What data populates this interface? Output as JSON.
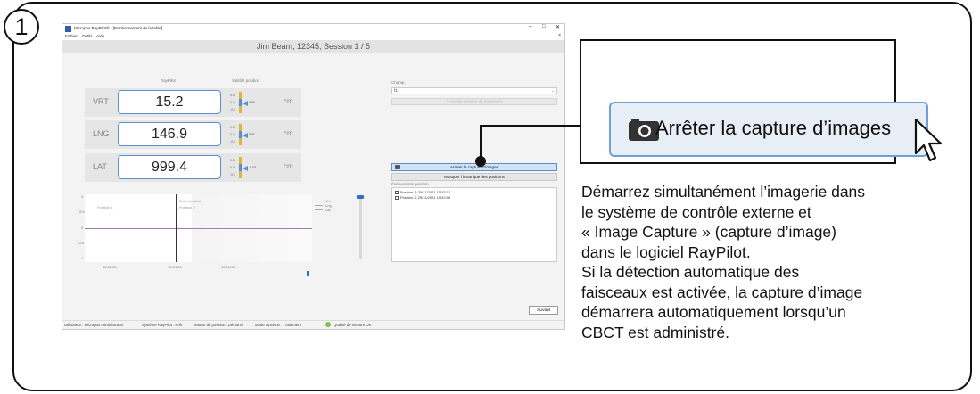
{
  "step_number": "1",
  "app": {
    "title": "Micropos RayPilot® - [Positionnement de la table]",
    "window_controls": [
      "–",
      "□",
      "✕"
    ],
    "menu": [
      "Fichier",
      "Outils",
      "Aide"
    ],
    "menu_close": "×",
    "session": "Jim Beam, 12345, Session 1 / 5",
    "headers": {
      "raypilot": "RayPilot",
      "validity": "Validité position"
    },
    "positions": [
      {
        "axis": "VRT",
        "value": "15.2",
        "ticks": [
          "0.5",
          "0.0",
          "-0.5"
        ],
        "gauge_value": "0.00",
        "unit": "cm"
      },
      {
        "axis": "LNG",
        "value": "146.9",
        "ticks": [
          "0.5",
          "0.0",
          "-0.5"
        ],
        "gauge_value": "0.01",
        "unit": "cm"
      },
      {
        "axis": "LAT",
        "value": "999.4",
        "ticks": [
          "0.5",
          "0.0",
          "-0.5"
        ],
        "gauge_value": "-0.03",
        "unit": "cm"
      }
    ],
    "chart": {
      "y_ticks": [
        "1",
        "0.5",
        "0",
        "-0.5",
        "-1"
      ],
      "x_ticks": [
        "15:22:30",
        "15:24:00",
        "15:25:30"
      ],
      "annotations": {
        "position1": "Position 1",
        "position2": "Position 2",
        "label_top": "Début position"
      },
      "legend": [
        "Vrt",
        "Lng",
        "Lat"
      ]
    },
    "side": {
      "field_label": "Champ",
      "field_value": "f1",
      "new_position_button": "Nouvelle position de traitement",
      "capture_button": "Arrêter la capture d'images",
      "history_button": "Masquer l'historique des positions",
      "events_label": "Événements position",
      "events": [
        "Position 1: 25/11/2021 15:33:12",
        "Position 2: 25/11/2021 15:33:59"
      ],
      "next_button": "Suivant"
    },
    "status": {
      "user": "Utilisateur : Micropos Administrator",
      "system": "Système RayPilot : Prêt",
      "motor": "Moteur de position : Démarré",
      "mode": "Mode système : Traitement",
      "quality": "Qualité de mesure OK"
    }
  },
  "callout": {
    "button_label": "Arrêter la capture d’images",
    "instruction_lines": [
      "Démarrez simultanément l’imagerie dans",
      "le système de contrôle externe et",
      "« Image Capture » (capture d’image)",
      "dans le logiciel RayPilot.",
      "Si la détection automatique des",
      "faisceaux est activée, la capture d’image",
      "démarrera automatiquement lorsqu’un",
      "CBCT est administré."
    ]
  }
}
